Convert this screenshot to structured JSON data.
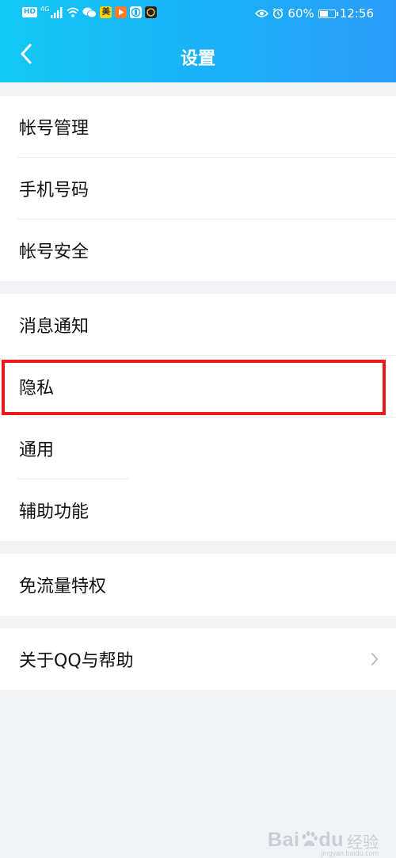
{
  "status_bar": {
    "hd_badge": "HD",
    "network_type": "4G",
    "app_icon_mei": "美",
    "battery_percent": "60%",
    "battery_level": 0.6,
    "time": "12:56",
    "icons": [
      "signal-icon",
      "wifi-icon",
      "wechat-icon",
      "meituan-app-icon",
      "video-app-icon",
      "hand-app-icon",
      "app-icon",
      "eye-icon",
      "alarm-icon",
      "battery-icon"
    ]
  },
  "header": {
    "title": "设置",
    "back_icon": "chevron-left-icon"
  },
  "settings_groups": [
    {
      "items": [
        {
          "label": "帐号管理"
        },
        {
          "label": "手机号码"
        },
        {
          "label": "帐号安全"
        }
      ]
    },
    {
      "items": [
        {
          "label": "消息通知"
        },
        {
          "label": "隐私",
          "highlighted": true
        },
        {
          "label": "通用"
        },
        {
          "label": "辅助功能"
        }
      ]
    },
    {
      "items": [
        {
          "label": "免流量特权"
        }
      ]
    },
    {
      "items": [
        {
          "label": "关于QQ与帮助",
          "icon": "chevron-right-icon"
        }
      ]
    }
  ],
  "watermark": {
    "brand_text": "Bai",
    "brand_text_2": "du",
    "service_text": "经验",
    "url": "jingyan.baidu.com"
  },
  "colors": {
    "header_gradient_start": "#12c8f6",
    "header_gradient_end": "#2a9cf8",
    "highlight_border": "#ec1b1b",
    "background": "#f2f3f7"
  }
}
